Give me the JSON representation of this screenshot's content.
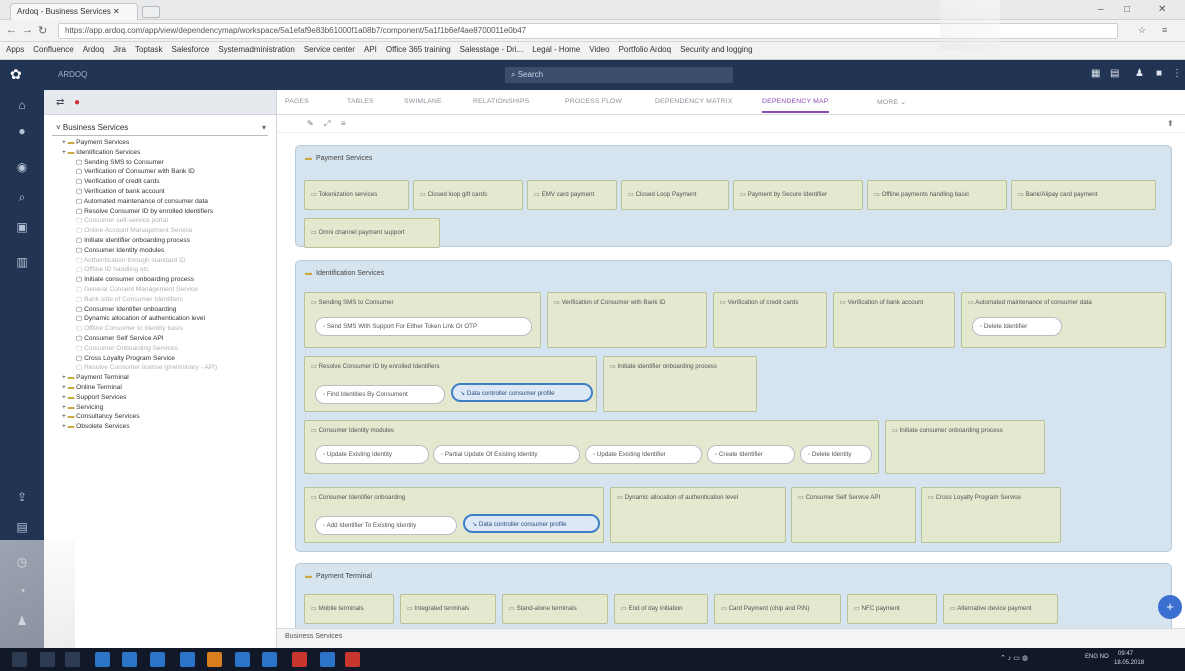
{
  "browser": {
    "tab_title": "Ardoq - Business Services",
    "url": "https://app.ardoq.com/app/view/dependencymap/workspace/5a1efaf9e83b61000f1a08b7/component/5a1f1b6ef4ae8700011e0b47",
    "bookmarks": [
      "Apps",
      "Confluence",
      "Ardoq",
      "Jira",
      "Toptask",
      "Salesforce",
      "Systemadministration",
      "Service center",
      "API",
      "Office 365 training",
      "Salesstage - Dri...",
      "Legal - Home",
      "Video",
      "Portfolio Ardoq",
      "Security and logging"
    ]
  },
  "app": {
    "name": "ARDOQ",
    "search_placeholder": "Search"
  },
  "explorer": {
    "workspace_select": "Business Services",
    "tree": [
      {
        "text": "Payment Services",
        "level": 1,
        "folder": true,
        "dim": false
      },
      {
        "text": "Identification Services",
        "level": 1,
        "folder": true,
        "dim": false
      },
      {
        "text": "Sending SMS to Consumer",
        "level": 2,
        "folder": false,
        "dim": false
      },
      {
        "text": "Verification of Consumer with Bank ID",
        "level": 2,
        "folder": false,
        "dim": false
      },
      {
        "text": "Verification of credit cards",
        "level": 2,
        "folder": false,
        "dim": false
      },
      {
        "text": "Verification of bank account",
        "level": 2,
        "folder": false,
        "dim": false
      },
      {
        "text": "Automated maintenance of consumer data",
        "level": 2,
        "folder": false,
        "dim": false
      },
      {
        "text": "Resolve Consumer ID by enrolled Identifiers",
        "level": 2,
        "folder": false,
        "dim": false
      },
      {
        "text": "Consumer self-service portal",
        "level": 2,
        "folder": false,
        "dim": true
      },
      {
        "text": "Online Account Management Service",
        "level": 2,
        "folder": false,
        "dim": true
      },
      {
        "text": "Initiate identifier onboarding process",
        "level": 2,
        "folder": false,
        "dim": false
      },
      {
        "text": "Consumer Identity modules",
        "level": 2,
        "folder": false,
        "dim": false
      },
      {
        "text": "Authentication through standard ID",
        "level": 2,
        "folder": false,
        "dim": true
      },
      {
        "text": "Offline ID handling etc",
        "level": 2,
        "folder": false,
        "dim": true
      },
      {
        "text": "Initiate consumer onboarding process",
        "level": 2,
        "folder": false,
        "dim": false
      },
      {
        "text": "General Consent Management Service",
        "level": 2,
        "folder": false,
        "dim": true
      },
      {
        "text": "Bank side of Consumer Identifiers",
        "level": 2,
        "folder": false,
        "dim": true
      },
      {
        "text": "Consumer Identifier onboarding",
        "level": 2,
        "folder": false,
        "dim": false
      },
      {
        "text": "Dynamic allocation of authentication level",
        "level": 2,
        "folder": false,
        "dim": false
      },
      {
        "text": "Offline Consumer to Identity basis",
        "level": 2,
        "folder": false,
        "dim": true
      },
      {
        "text": "Consumer Self Service API",
        "level": 2,
        "folder": false,
        "dim": false
      },
      {
        "text": "Consumer Onboarding Services",
        "level": 2,
        "folder": false,
        "dim": true
      },
      {
        "text": "Cross Loyalty Program Service",
        "level": 2,
        "folder": false,
        "dim": false
      },
      {
        "text": "Resolve Consumer license (preliminary - API)",
        "level": 2,
        "folder": false,
        "dim": true
      },
      {
        "text": "Payment Terminal",
        "level": 1,
        "folder": true,
        "dim": false
      },
      {
        "text": "Online Terminal",
        "level": 1,
        "folder": true,
        "dim": false
      },
      {
        "text": "Support Services",
        "level": 1,
        "folder": true,
        "dim": false
      },
      {
        "text": "Servicing",
        "level": 1,
        "folder": true,
        "dim": false
      },
      {
        "text": "Consultancy Services",
        "level": 1,
        "folder": true,
        "dim": false
      },
      {
        "text": "Obsolete Services",
        "level": 1,
        "folder": true,
        "dim": false
      }
    ]
  },
  "tabs": [
    "PAGES",
    "TABLES",
    "SWIMLANE",
    "RELATIONSHIPS",
    "PROCESS FLOW",
    "DEPENDENCY MATRIX",
    "DEPENDENCY MAP",
    "MORE"
  ],
  "active_tab": "DEPENDENCY MAP",
  "groups": [
    {
      "label": "Payment Services",
      "items": [
        "Tokenization services",
        "Closed loop gift cards",
        "EMV card payment",
        "Closed Loop Payment",
        "Payment by Secure Identifier",
        "Offline payments handling basic",
        "Bank/Alipay card payment",
        "Omni channel payment support"
      ]
    },
    {
      "label": "Identification Services",
      "boxes": [
        {
          "label": "Sending SMS to Consumer",
          "chips": [
            "Send SMS With Support For Either Token Link Or OTP"
          ]
        },
        {
          "label": "Verification of Consumer with Bank ID",
          "chips": []
        },
        {
          "label": "Verification of credit cards",
          "chips": []
        },
        {
          "label": "Verification of bank account",
          "chips": []
        },
        {
          "label": "Automated maintenance of consumer data",
          "chips": [
            "Delete Identifier"
          ]
        },
        {
          "label": "Resolve Consumer ID by enrolled Identifiers",
          "chips": [
            "Find Identities By Consument",
            "Data controller consumer profile"
          ]
        },
        {
          "label": "Initiate identifier onboarding process",
          "chips": []
        },
        {
          "label": "Consumer Identity modules",
          "chips": [
            "Update Existing Identity",
            "Partial Update Of Existing Identity",
            "Update Existing Identifier",
            "Create Identifier",
            "Delete Identity"
          ]
        },
        {
          "label": "Initiate consumer onboarding process",
          "chips": []
        },
        {
          "label": "Consumer Identifier onboarding",
          "chips": [
            "Add Identifier To Existing Identity",
            "Data controller consumer profile"
          ]
        },
        {
          "label": "Dynamic allocation of authentication level",
          "chips": []
        },
        {
          "label": "Consumer Self Service API",
          "chips": []
        },
        {
          "label": "Cross Loyalty Program Service",
          "chips": []
        }
      ]
    },
    {
      "label": "Payment Terminal",
      "items": [
        "Mobile terminals",
        "Integrated terminals",
        "Stand-alone terminals",
        "End of day initiation",
        "Card Payment (chip and PIN)",
        "NFC payment",
        "Alternative device payment"
      ]
    }
  ],
  "footer": {
    "breadcrumb": "Business Services"
  },
  "taskbar": {
    "lang": "ENG NO",
    "time": "09:47",
    "date": "18.05.2018"
  },
  "colors": {
    "accent": "#8a4bb4",
    "header": "#223453",
    "group_bg": "#d6e4ef",
    "box_bg": "#e3e8cf",
    "selected_border": "#3f7fc8"
  }
}
